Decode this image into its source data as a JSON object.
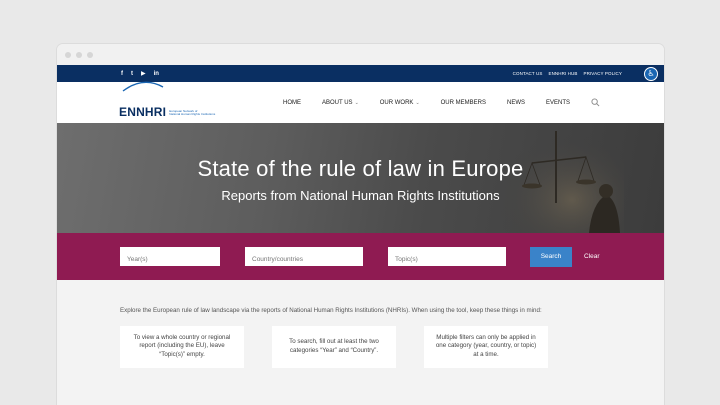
{
  "social": [
    "f",
    "t",
    "▶",
    "in"
  ],
  "top_links": [
    "CONTACT US",
    "ENNHRI HUB",
    "PRIVACY POLICY"
  ],
  "logo": {
    "word": "ENNHRI",
    "sub_line1": "European Network of",
    "sub_line2": "National Human Rights Institutions"
  },
  "nav": [
    {
      "label": "HOME",
      "dropdown": false
    },
    {
      "label": "ABOUT US",
      "dropdown": true
    },
    {
      "label": "OUR WORK",
      "dropdown": true
    },
    {
      "label": "OUR MEMBERS",
      "dropdown": false
    },
    {
      "label": "NEWS",
      "dropdown": false
    },
    {
      "label": "EVENTS",
      "dropdown": false
    }
  ],
  "hero": {
    "title": "State of the rule of law in Europe",
    "subtitle": "Reports from National Human Rights Institutions"
  },
  "filters": {
    "year_placeholder": "Year(s)",
    "country_placeholder": "Country/countries",
    "topic_placeholder": "Topic(s)",
    "search_label": "Search",
    "clear_label": "Clear"
  },
  "intro": "Explore the European rule of law landscape via the reports of National Human Rights Institutions (NHRIs). When using the tool, keep these things in mind:",
  "cards": [
    "To view a whole country or regional report (including the EU), leave “Topic(s)” empty.",
    "To search, fill out at least the two categories “Year” and “Country”.",
    "Multiple filters can only be applied in one category (year, country, or topic) at a time."
  ],
  "colors": {
    "topbar": "#0a2f62",
    "filterbar": "#8f1b52",
    "search_button": "#3a83c9"
  }
}
